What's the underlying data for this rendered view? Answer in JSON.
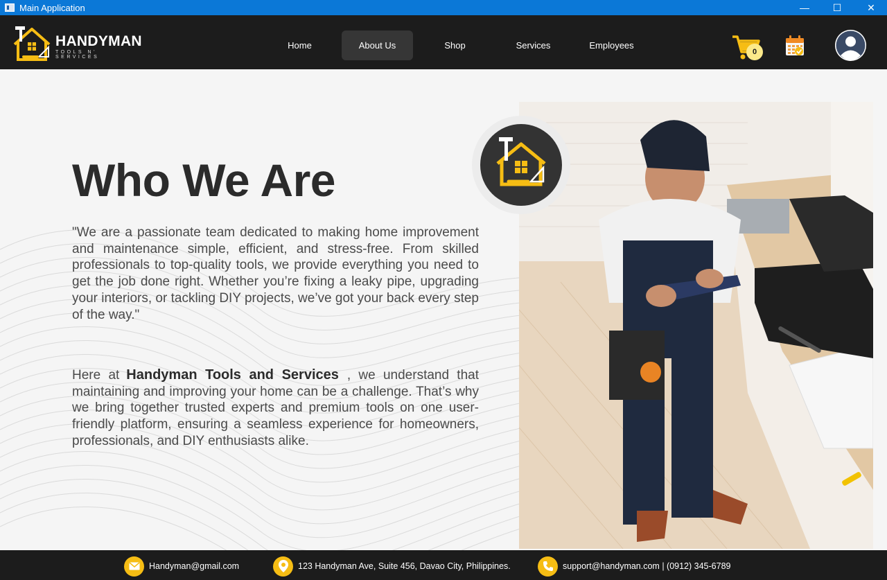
{
  "window": {
    "title": "Main Application",
    "min": "—",
    "max": "☐",
    "close": "✕"
  },
  "brand": {
    "name": "HANDYMAN",
    "tagline": "TOOLS N' SERVICES"
  },
  "nav": {
    "items": [
      {
        "label": "Home",
        "active": false
      },
      {
        "label": "About Us",
        "active": true
      },
      {
        "label": "Shop",
        "active": false
      },
      {
        "label": "Services",
        "active": false
      },
      {
        "label": "Employees",
        "active": false
      }
    ],
    "cart_count": "0"
  },
  "about": {
    "heading": "Who We Are",
    "quote": "\"We are a passionate team dedicated to making home improvement and maintenance simple, efficient, and stress-free. From skilled professionals to top-quality tools, we provide everything you need to get the job done right. Whether you’re fixing a leaky pipe, upgrading your interiors, or tackling DIY projects, we’ve got your back every step of the way.\"",
    "para_prefix": "Here at",
    "para_brand": "Handyman Tools and Services",
    "para_suffix": ", we understand that maintaining and improving your home can be a challenge. That’s why we bring together trusted experts and premium tools on one user-friendly platform, ensuring a seamless experience for homeowners, professionals, and DIY enthusiasts alike."
  },
  "footer": {
    "email": "Handyman@gmail.com",
    "address": "123 Handyman Ave, Suite 456, Davao City, Philippines.",
    "support": "support@handyman.com | (0912) 345-6789"
  },
  "colors": {
    "accent": "#f6bd14",
    "dark": "#1c1c1c",
    "titlebar": "#0b78d7"
  }
}
